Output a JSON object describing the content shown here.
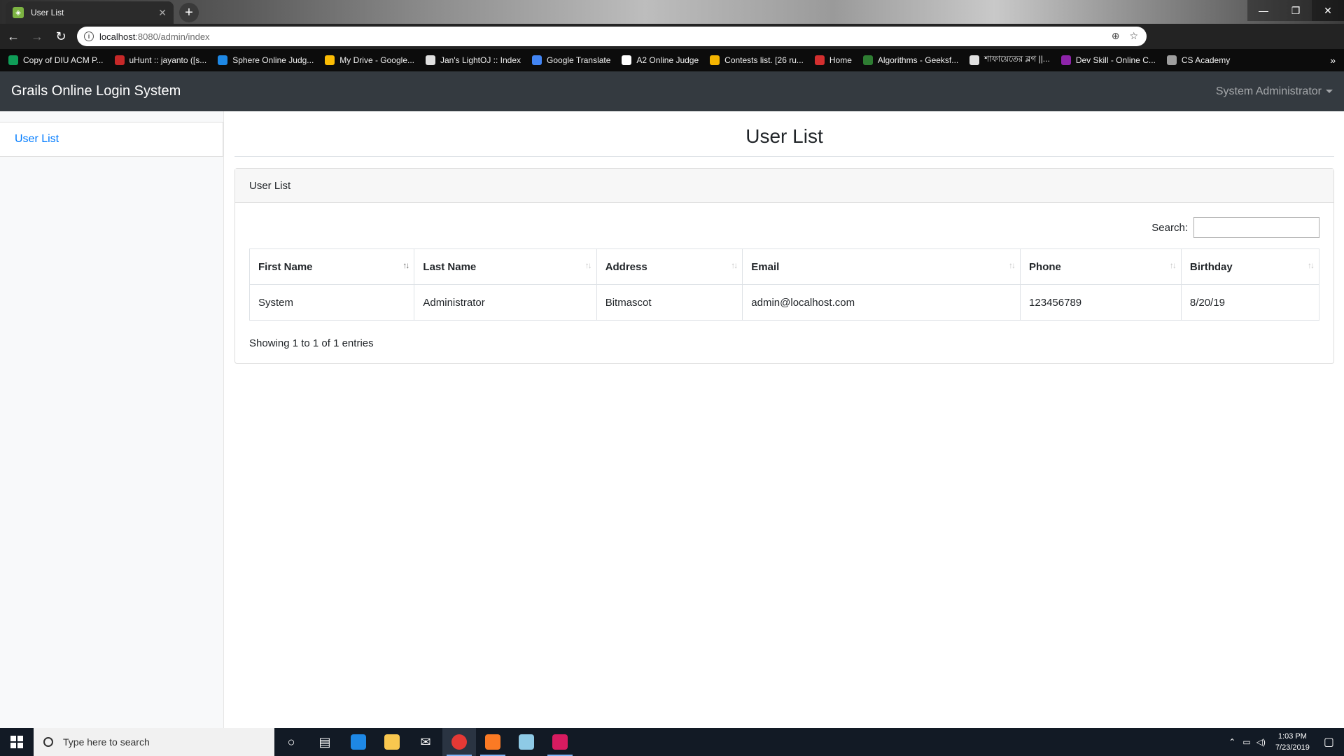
{
  "browser": {
    "tab_title": "User List",
    "url_host": "localhost",
    "url_path": ":8080/admin/index",
    "bookmarks": [
      {
        "label": "Copy of DIU ACM P...",
        "color": "#0f9d58"
      },
      {
        "label": "uHunt :: jayanto ([s...",
        "color": "#c62828"
      },
      {
        "label": "Sphere Online Judg...",
        "color": "#1e88e5"
      },
      {
        "label": "My Drive - Google...",
        "color": "#fbbc04"
      },
      {
        "label": "Jan's LightOJ :: Index",
        "color": "#e0e0e0"
      },
      {
        "label": "Google Translate",
        "color": "#4285f4"
      },
      {
        "label": "A2 Online Judge",
        "color": "#ffffff"
      },
      {
        "label": "Contests list. [26 ru...",
        "color": "#f4b400"
      },
      {
        "label": "Home",
        "color": "#d32f2f"
      },
      {
        "label": "Algorithms - Geeksf...",
        "color": "#2e7d32"
      },
      {
        "label": "শাফায়েতের ব্লগ ||...",
        "color": "#e0e0e0"
      },
      {
        "label": "Dev Skill - Online C...",
        "color": "#8e24aa"
      },
      {
        "label": "CS Academy",
        "color": "#9e9e9e"
      }
    ]
  },
  "app": {
    "brand": "Grails Online Login System",
    "user_menu": "System Administrator",
    "sidebar_items": [
      {
        "label": "User List"
      }
    ],
    "page_title": "User List",
    "card_title": "User List",
    "search_label": "Search:",
    "search_value": "",
    "columns": [
      "First Name",
      "Last Name",
      "Address",
      "Email",
      "Phone",
      "Birthday"
    ],
    "rows": [
      [
        "System",
        "Administrator",
        "Bitmascot",
        "admin@localhost.com",
        "123456789",
        "8/20/19"
      ]
    ],
    "info": "Showing 1 to 1 of 1 entries"
  },
  "taskbar": {
    "search_placeholder": "Type here to search",
    "time": "1:03 PM",
    "date": "7/23/2019"
  },
  "colors": {
    "navbar": "#343a40",
    "link": "#007bff",
    "sidebar": "#f8f9fa"
  }
}
